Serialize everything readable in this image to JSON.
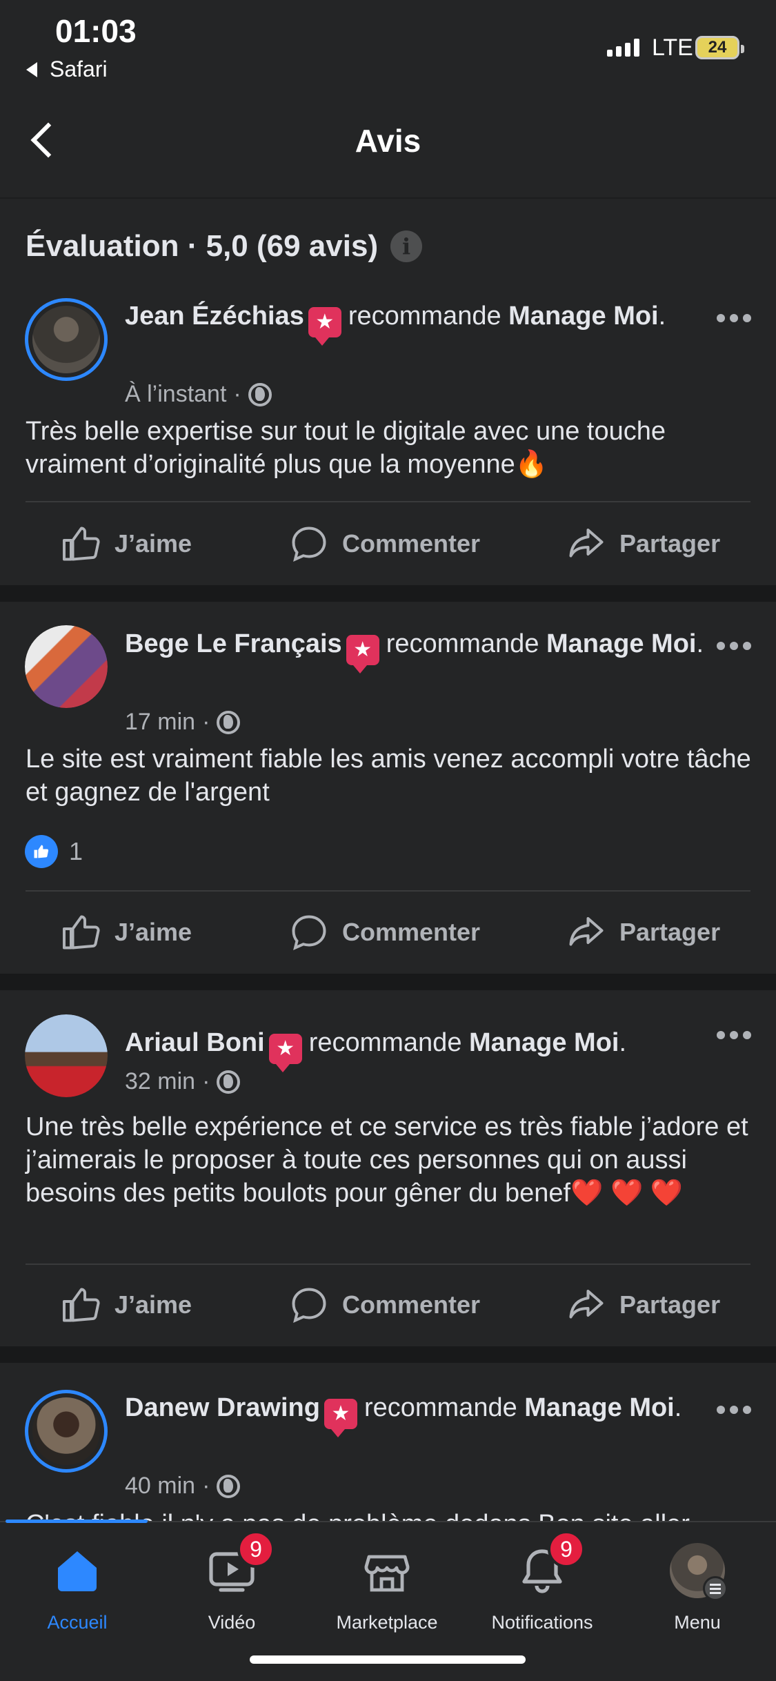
{
  "status_bar": {
    "time": "01:03",
    "back_app": "Safari",
    "network": "LTE",
    "battery": "24"
  },
  "header": {
    "title": "Avis"
  },
  "rating": {
    "text": "Évaluation · 5,0 (69 avis)",
    "info_icon": "i"
  },
  "posts": [
    {
      "author": "Jean Ézéchias",
      "verb": "recommande",
      "page": "Manage Moi",
      "time": "À l’instant",
      "text": "Très belle expertise sur tout le digitale avec une touche vraiment d’originalité plus que la moyenne🔥",
      "likes": ""
    },
    {
      "author": "Bege Le Français",
      "verb": "recommande",
      "page": "Manage Moi",
      "time": "17 min",
      "text": "Le site est vraiment fiable les amis venez accompli votre tâche et gagnez de l'argent",
      "likes": "1"
    },
    {
      "author": "Ariaul Boni",
      "verb": "recommande",
      "page": "Manage Moi",
      "time": "32 min",
      "text": "Une très belle expérience et ce service es très fiable j’adore et j’aimerais le proposer à toute ces personnes qui on aussi besoins des petits boulots pour gêner du benef❤️ ❤️ ❤️",
      "likes": ""
    },
    {
      "author": "Danew Drawing",
      "verb": "recommande",
      "page": "Manage Moi",
      "time": "40 min",
      "text": "C'est fiable il n'y a pas de problème dedans Bon site aller",
      "likes": ""
    }
  ],
  "actions": {
    "like": "J’aime",
    "comment": "Commenter",
    "share": "Partager"
  },
  "tabbar": {
    "home": "Accueil",
    "video": "Vidéo",
    "video_badge": "9",
    "marketplace": "Marketplace",
    "notifications": "Notifications",
    "notifications_badge": "9",
    "menu": "Menu"
  },
  "colors": {
    "accent": "#2d88ff",
    "background": "#242526",
    "badge": "#e41e3f",
    "star_badge": "#e0325c"
  }
}
